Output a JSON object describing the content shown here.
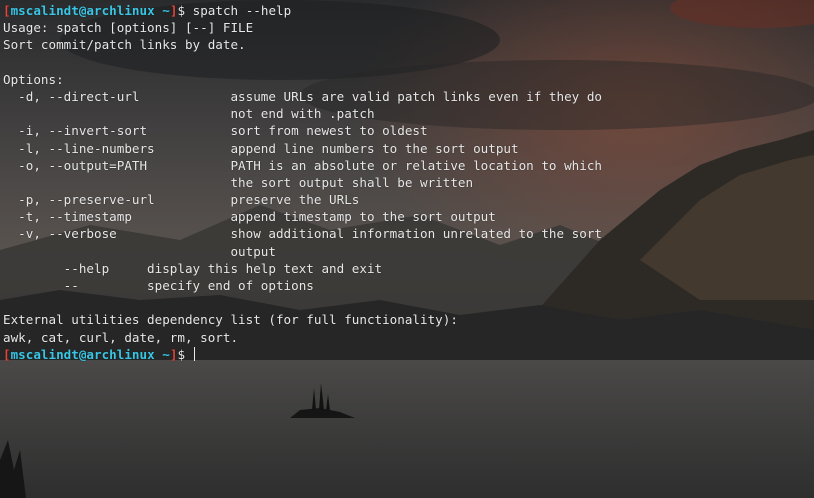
{
  "prompt": {
    "user_host": "mscalindt@archlinux",
    "path": "~",
    "open_bracket": "[",
    "close_bracket": "]",
    "dollar": "$"
  },
  "command": "spatch --help",
  "output_lines": [
    "Usage: spatch [options] [--] FILE",
    "Sort commit/patch links by date.",
    "",
    "Options:",
    "  -d, --direct-url            assume URLs are valid patch links even if they do",
    "                              not end with .patch",
    "  -i, --invert-sort           sort from newest to oldest",
    "  -l, --line-numbers          append line numbers to the sort output",
    "  -o, --output=PATH           PATH is an absolute or relative location to which",
    "                              the sort output shall be written",
    "  -p, --preserve-url          preserve the URLs",
    "  -t, --timestamp             append timestamp to the sort output",
    "  -v, --verbose               show additional information unrelated to the sort",
    "                              output",
    "        --help     display this help text and exit",
    "        --         specify end of options",
    "",
    "External utilities dependency list (for full functionality):",
    "awk, cat, curl, date, rm, sort."
  ],
  "colors": {
    "prompt_bracket": "#e0463b",
    "prompt_user": "#38c6e4",
    "text": "#e8e8e8"
  },
  "background": "mountain-lake-wallpaper"
}
